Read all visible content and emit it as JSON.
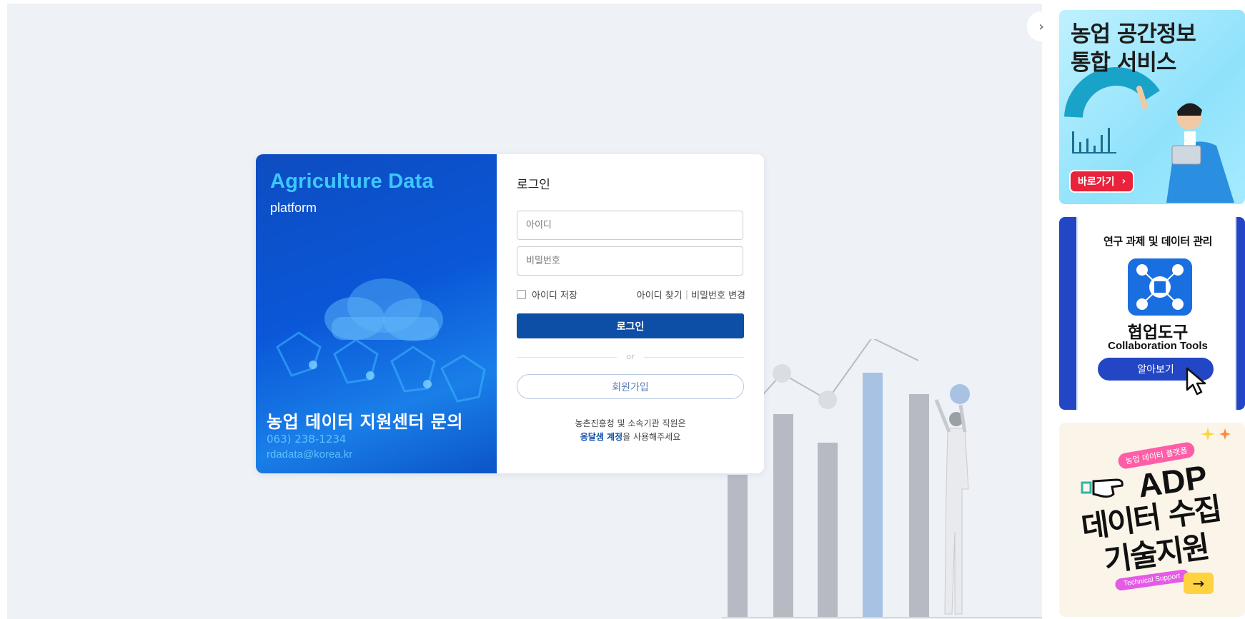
{
  "brand": {
    "title": "Agriculture Data",
    "subtitle": "platform"
  },
  "contact": {
    "title": "농업 데이터 지원센터 문의",
    "phone": "063) 238-1234",
    "email": "rdadata@korea.kr"
  },
  "login": {
    "heading": "로그인",
    "id_placeholder": "아이디",
    "pw_placeholder": "비밀번호",
    "remember_label": "아이디 저장",
    "find_id": "아이디 찾기",
    "separator": "|",
    "change_pw": "비밀번호 변경",
    "submit_label": "로그인",
    "or_text": "or",
    "join_label": "회원가입",
    "notice_line1": "농촌진흥청 및 소속기관 직원은",
    "notice_highlight": "옹달샘 계정",
    "notice_line2_rest": "을 사용해주세요"
  },
  "side": {
    "toggle_icon": "chevron-right-icon",
    "toggle_glyph": "›",
    "banner1": {
      "title_line1": "농업 공간정보",
      "title_line2": "통합 서비스",
      "button_label": "바로가기",
      "button_glyph": "›"
    },
    "banner2": {
      "title": "연구 과제 및 데이터 관리",
      "name": "협업도구",
      "name_en": "Collaboration Tools",
      "button_label": "알아보기"
    },
    "banner3": {
      "badge": "농업 데이터 플랫폼",
      "line1": "ADP",
      "line2": "데이터 수집",
      "line3": "기술지원",
      "tag": "Technical Support",
      "arrow_glyph": "→"
    }
  },
  "colors": {
    "primary": "#0d4ea6",
    "brand_cyan": "#3cc8ff",
    "banner_red": "#e8233b",
    "banner_blue": "#2346c4",
    "page_bg": "#eef1f6"
  }
}
